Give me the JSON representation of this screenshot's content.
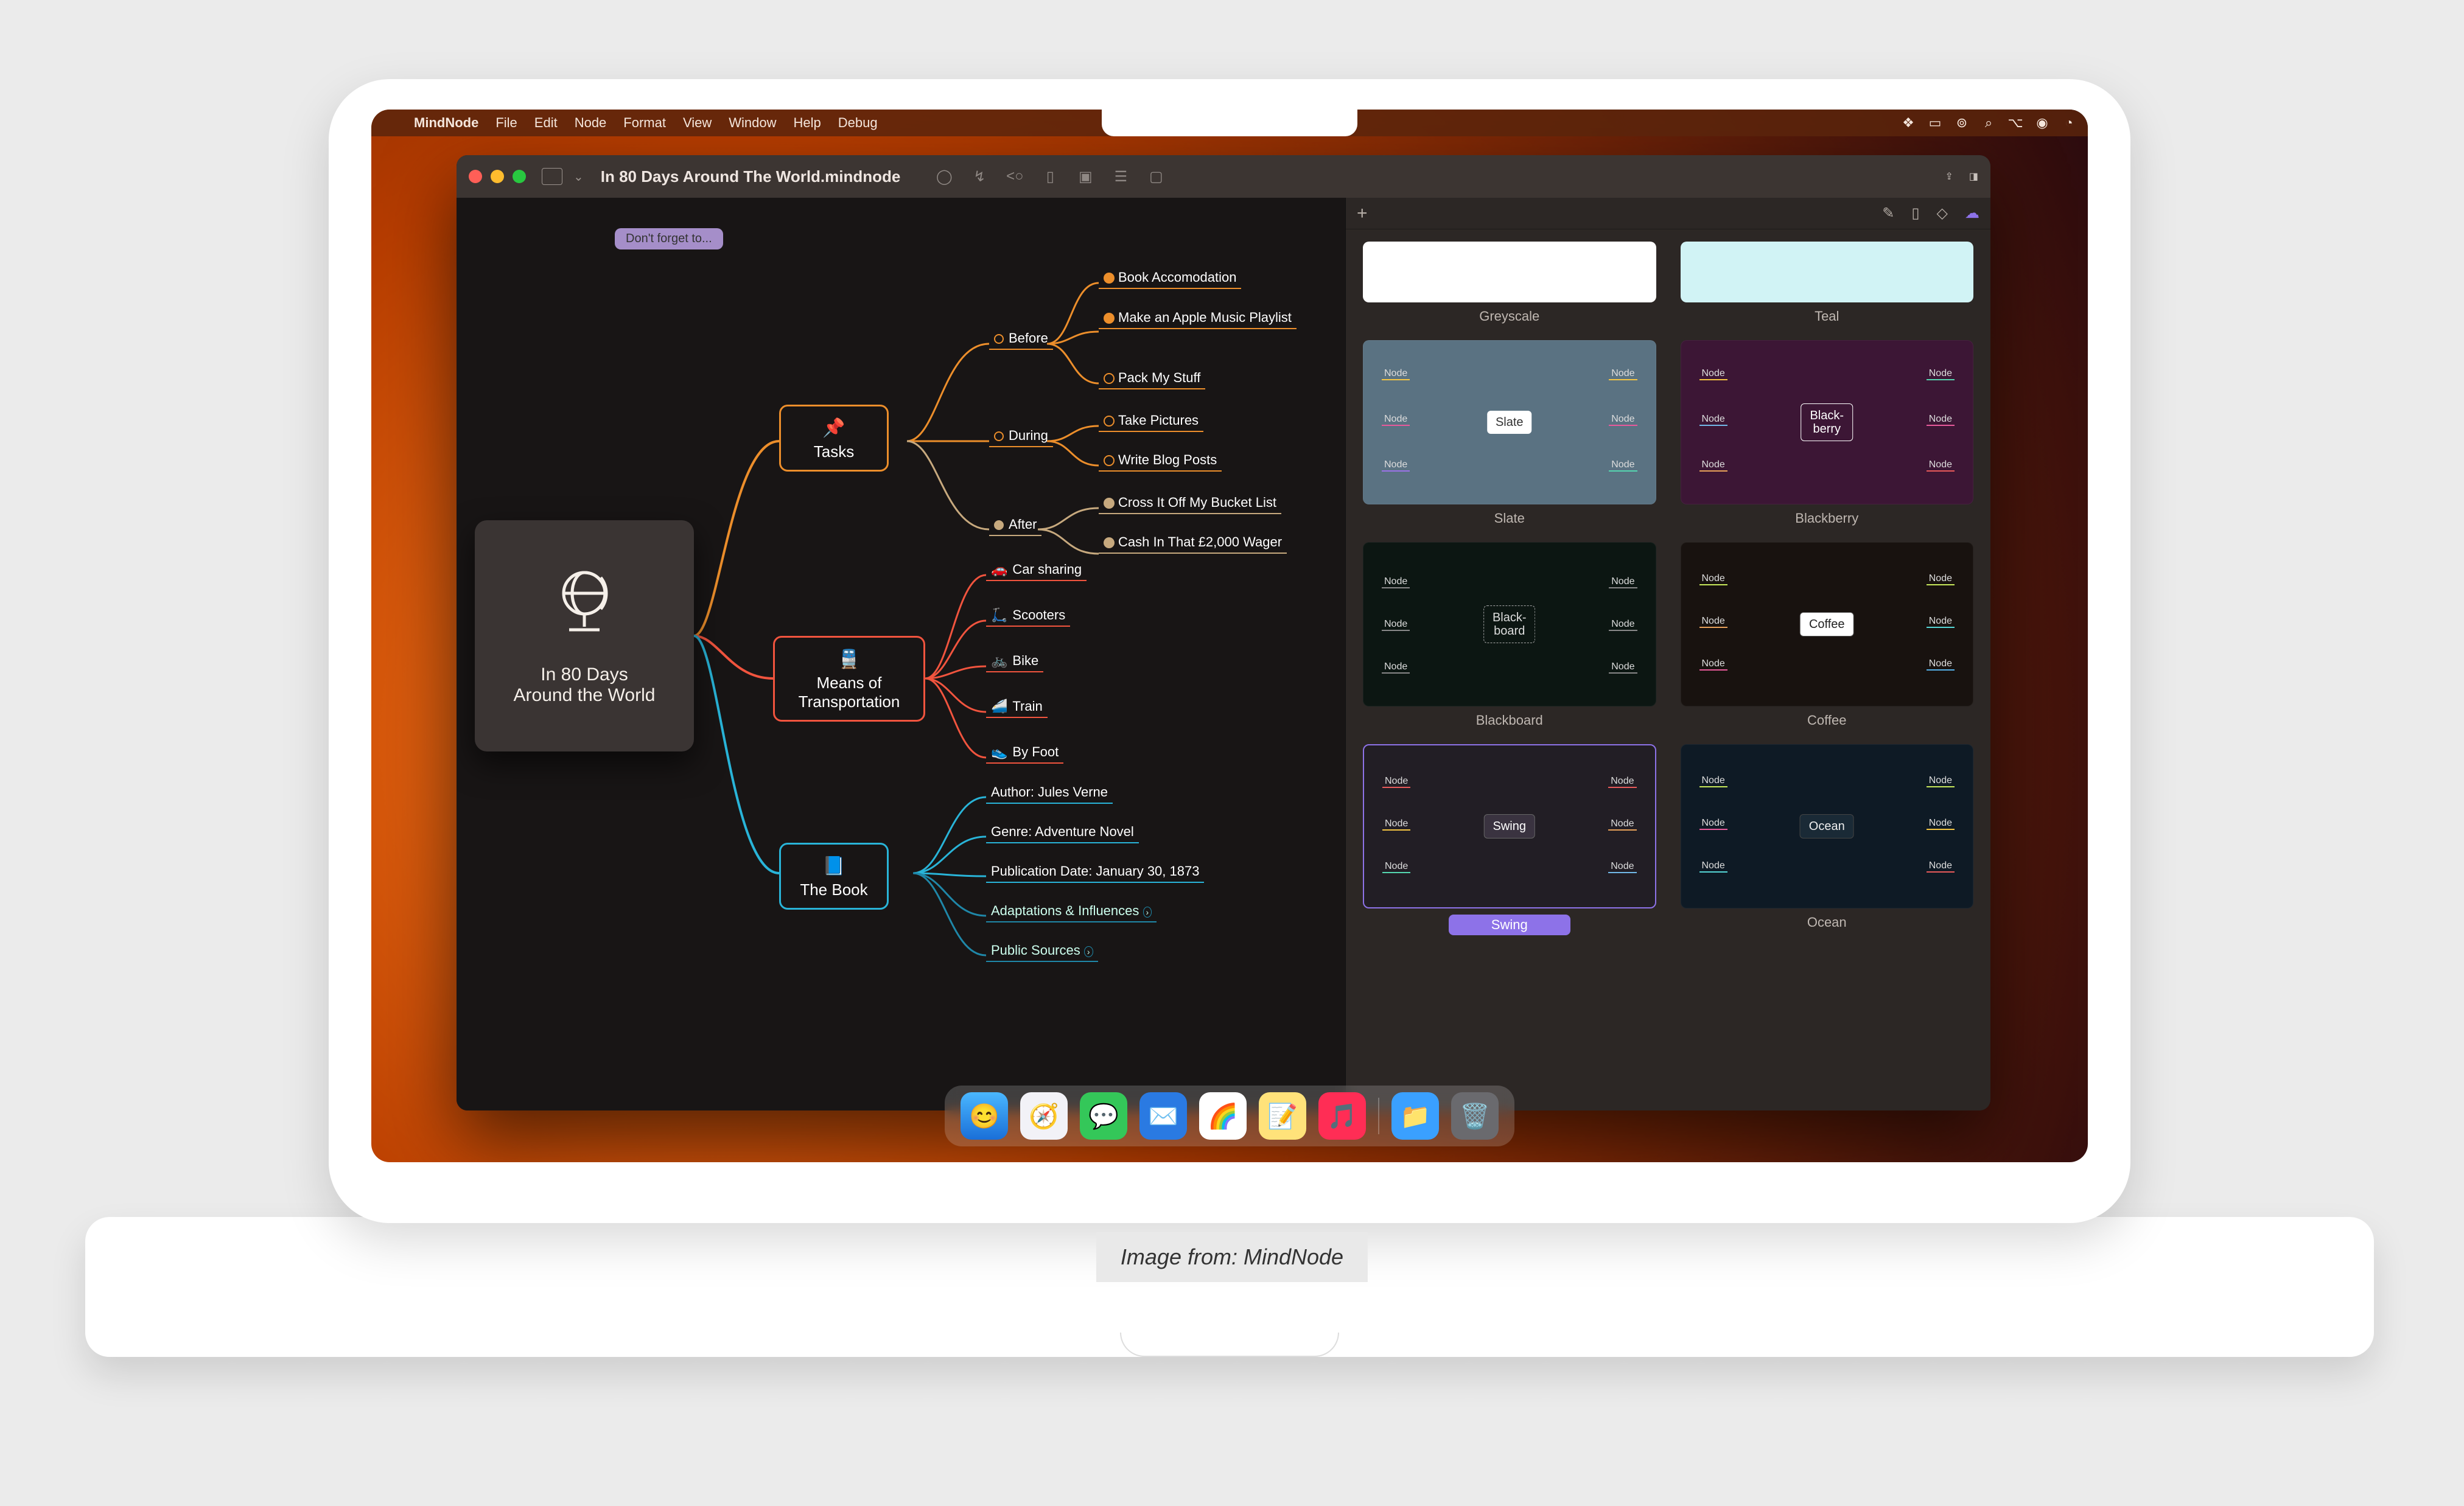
{
  "menubar": {
    "app_name": "MindNode",
    "items": [
      "File",
      "Edit",
      "Node",
      "Format",
      "View",
      "Window",
      "Help",
      "Debug"
    ]
  },
  "window": {
    "document_title": "In 80 Days Around The World.mindnode"
  },
  "mindmap": {
    "sticky_note": "Don't forget to...",
    "central_title_l1": "In 80 Days",
    "central_title_l2": "Around the World",
    "branches": {
      "tasks": {
        "label": "Tasks",
        "sub": {
          "before": {
            "label": "Before",
            "items": [
              "Book Accomodation",
              "Make an Apple Music Playlist",
              "Pack My Stuff"
            ]
          },
          "during": {
            "label": "During",
            "items": [
              "Take Pictures",
              "Write Blog Posts"
            ]
          },
          "after": {
            "label": "After",
            "items": [
              "Cross It Off My Bucket List",
              "Cash In That £2,000 Wager"
            ]
          }
        }
      },
      "means": {
        "label_l1": "Means of",
        "label_l2": "Transportation",
        "items": [
          "Car sharing",
          "Scooters",
          "Bike",
          "Train",
          "By Foot"
        ]
      },
      "book": {
        "label": "The Book",
        "items": [
          "Author: Jules Verne",
          "Genre: Adventure Novel",
          "Publication Date: January 30, 1873",
          "Adaptations & Influences",
          "Public Sources"
        ]
      }
    }
  },
  "themes": {
    "row1": {
      "greyscale": "Greyscale",
      "teal": "Teal"
    },
    "preview_text": {
      "slate": "Slate",
      "blackberry_l1": "Black-",
      "blackberry_l2": "berry",
      "blackboard_l1": "Black-",
      "blackboard_l2": "board",
      "coffee": "Coffee",
      "swing": "Swing",
      "ocean": "Ocean",
      "node": "Node"
    },
    "labels": {
      "slate": "Slate",
      "blackberry": "Blackberry",
      "blackboard": "Blackboard",
      "coffee": "Coffee",
      "swing": "Swing",
      "ocean": "Ocean"
    }
  },
  "dock": {
    "apps": [
      "Finder",
      "Safari",
      "Messages",
      "Mail",
      "MindNode",
      "Notes",
      "Music"
    ],
    "folder": "Downloads",
    "trash": "Trash"
  },
  "caption": "Image from: MindNode"
}
